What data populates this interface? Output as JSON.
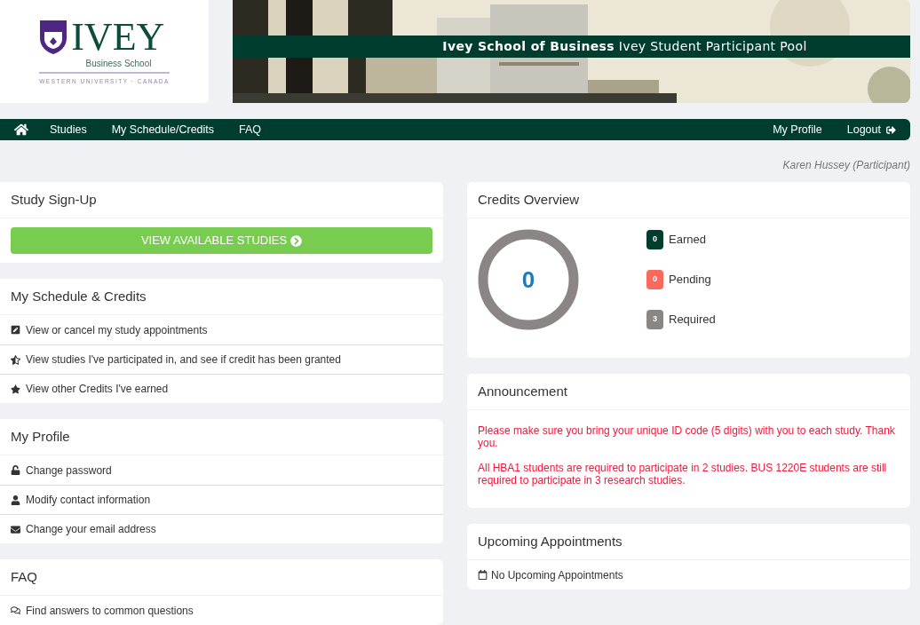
{
  "logo": {
    "wordmark": "IVEY",
    "subtitle": "Business School",
    "tagline": "WESTERN UNIVERSITY · CANADA"
  },
  "banner": {
    "title": "**Ivey School of Business** Ivey Student Participant Pool"
  },
  "nav": {
    "left": [
      "Studies",
      "My Schedule/Credits",
      "FAQ"
    ],
    "right": [
      "My Profile",
      "Logout"
    ]
  },
  "user": "Karen Hussey (Participant)",
  "left_panels": [
    {
      "title": "Study Sign-Up",
      "button": "VIEW AVAILABLE STUDIES"
    },
    {
      "title": "My Schedule & Credits",
      "links": [
        "View or cancel my study appointments",
        "View studies I've participated in, and see if credit has been granted",
        "View other Credits I've earned"
      ]
    },
    {
      "title": "My Profile",
      "links": [
        "Change password",
        "Modify contact information",
        "Change your email address"
      ]
    },
    {
      "title": "FAQ",
      "links": [
        "Find answers to common questions"
      ]
    }
  ],
  "credits": {
    "title": "Credits Overview",
    "total": "0",
    "legend": [
      {
        "count": "0",
        "label": "Earned",
        "color": "#003d2f"
      },
      {
        "count": "0",
        "label": "Pending",
        "color": "#f96a5c"
      },
      {
        "count": "3",
        "label": "Required",
        "color": "#8c8585"
      }
    ]
  },
  "announcement": {
    "title": "Announcement",
    "paragraphs": [
      "Please make sure you bring your unique ID code (5 digits) with you to each study. Thank you.",
      "All HBA1 students are required to participate in 2 studies. BUS 1220E students are still required to participate in 3 research studies."
    ]
  },
  "appointments": {
    "title": "Upcoming Appointments",
    "empty": "No Upcoming Appointments"
  }
}
